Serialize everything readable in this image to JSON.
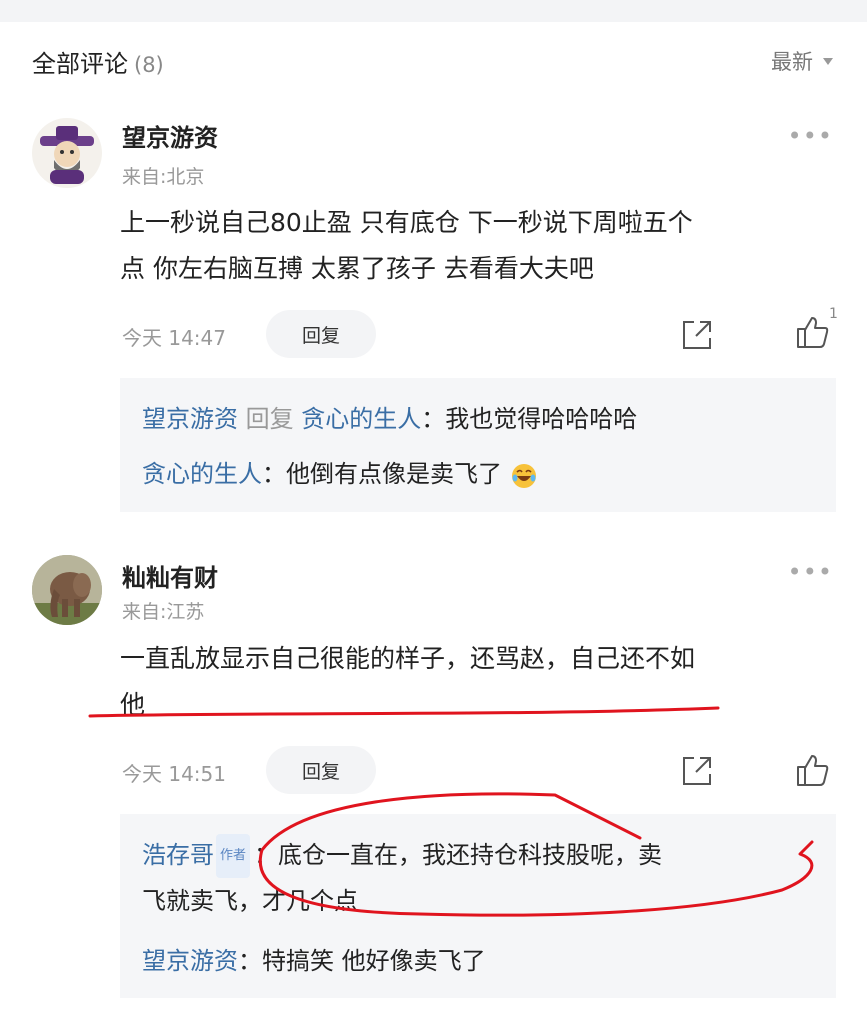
{
  "header": {
    "title": "全部评论",
    "count": "(8)",
    "sort_label": "最新"
  },
  "comments": [
    {
      "username": "望京游资",
      "location": "来自:北京",
      "text_line1": "上一秒说自己80止盈 只有底仓 下一秒说下周啦五个",
      "text_line2": "点 你左右脑互搏 太累了孩子 去看看大夫吧",
      "time": "今天 14:47",
      "reply_label": "回复",
      "like_count": "1",
      "replies": [
        {
          "from": "望京游资",
          "reply_word": "回复",
          "to": "贪心的生人",
          "sep": "：",
          "text": "我也觉得哈哈哈哈"
        },
        {
          "from": "贪心的生人",
          "sep": "：",
          "text": "他倒有点像是卖飞了"
        }
      ]
    },
    {
      "username": "籼籼有财",
      "location": "来自:江苏",
      "text_line1": "一直乱放显示自己很能的样子，还骂赵，自己还不如",
      "text_line2": "他",
      "time": "今天 14:51",
      "reply_label": "回复",
      "replies": [
        {
          "from": "浩存哥",
          "badge": "作者",
          "sep": "：",
          "text_line1": "底仓一直在，我还持仓科技股呢，卖",
          "text_line2": "飞就卖飞，才几个点"
        },
        {
          "from": "望京游资",
          "sep": "：",
          "text": "特搞笑 他好像卖飞了"
        }
      ]
    }
  ],
  "colors": {
    "link_blue": "#3a6ea5",
    "annotation_red": "#e0141e",
    "reply_bg": "#f5f6f8"
  }
}
